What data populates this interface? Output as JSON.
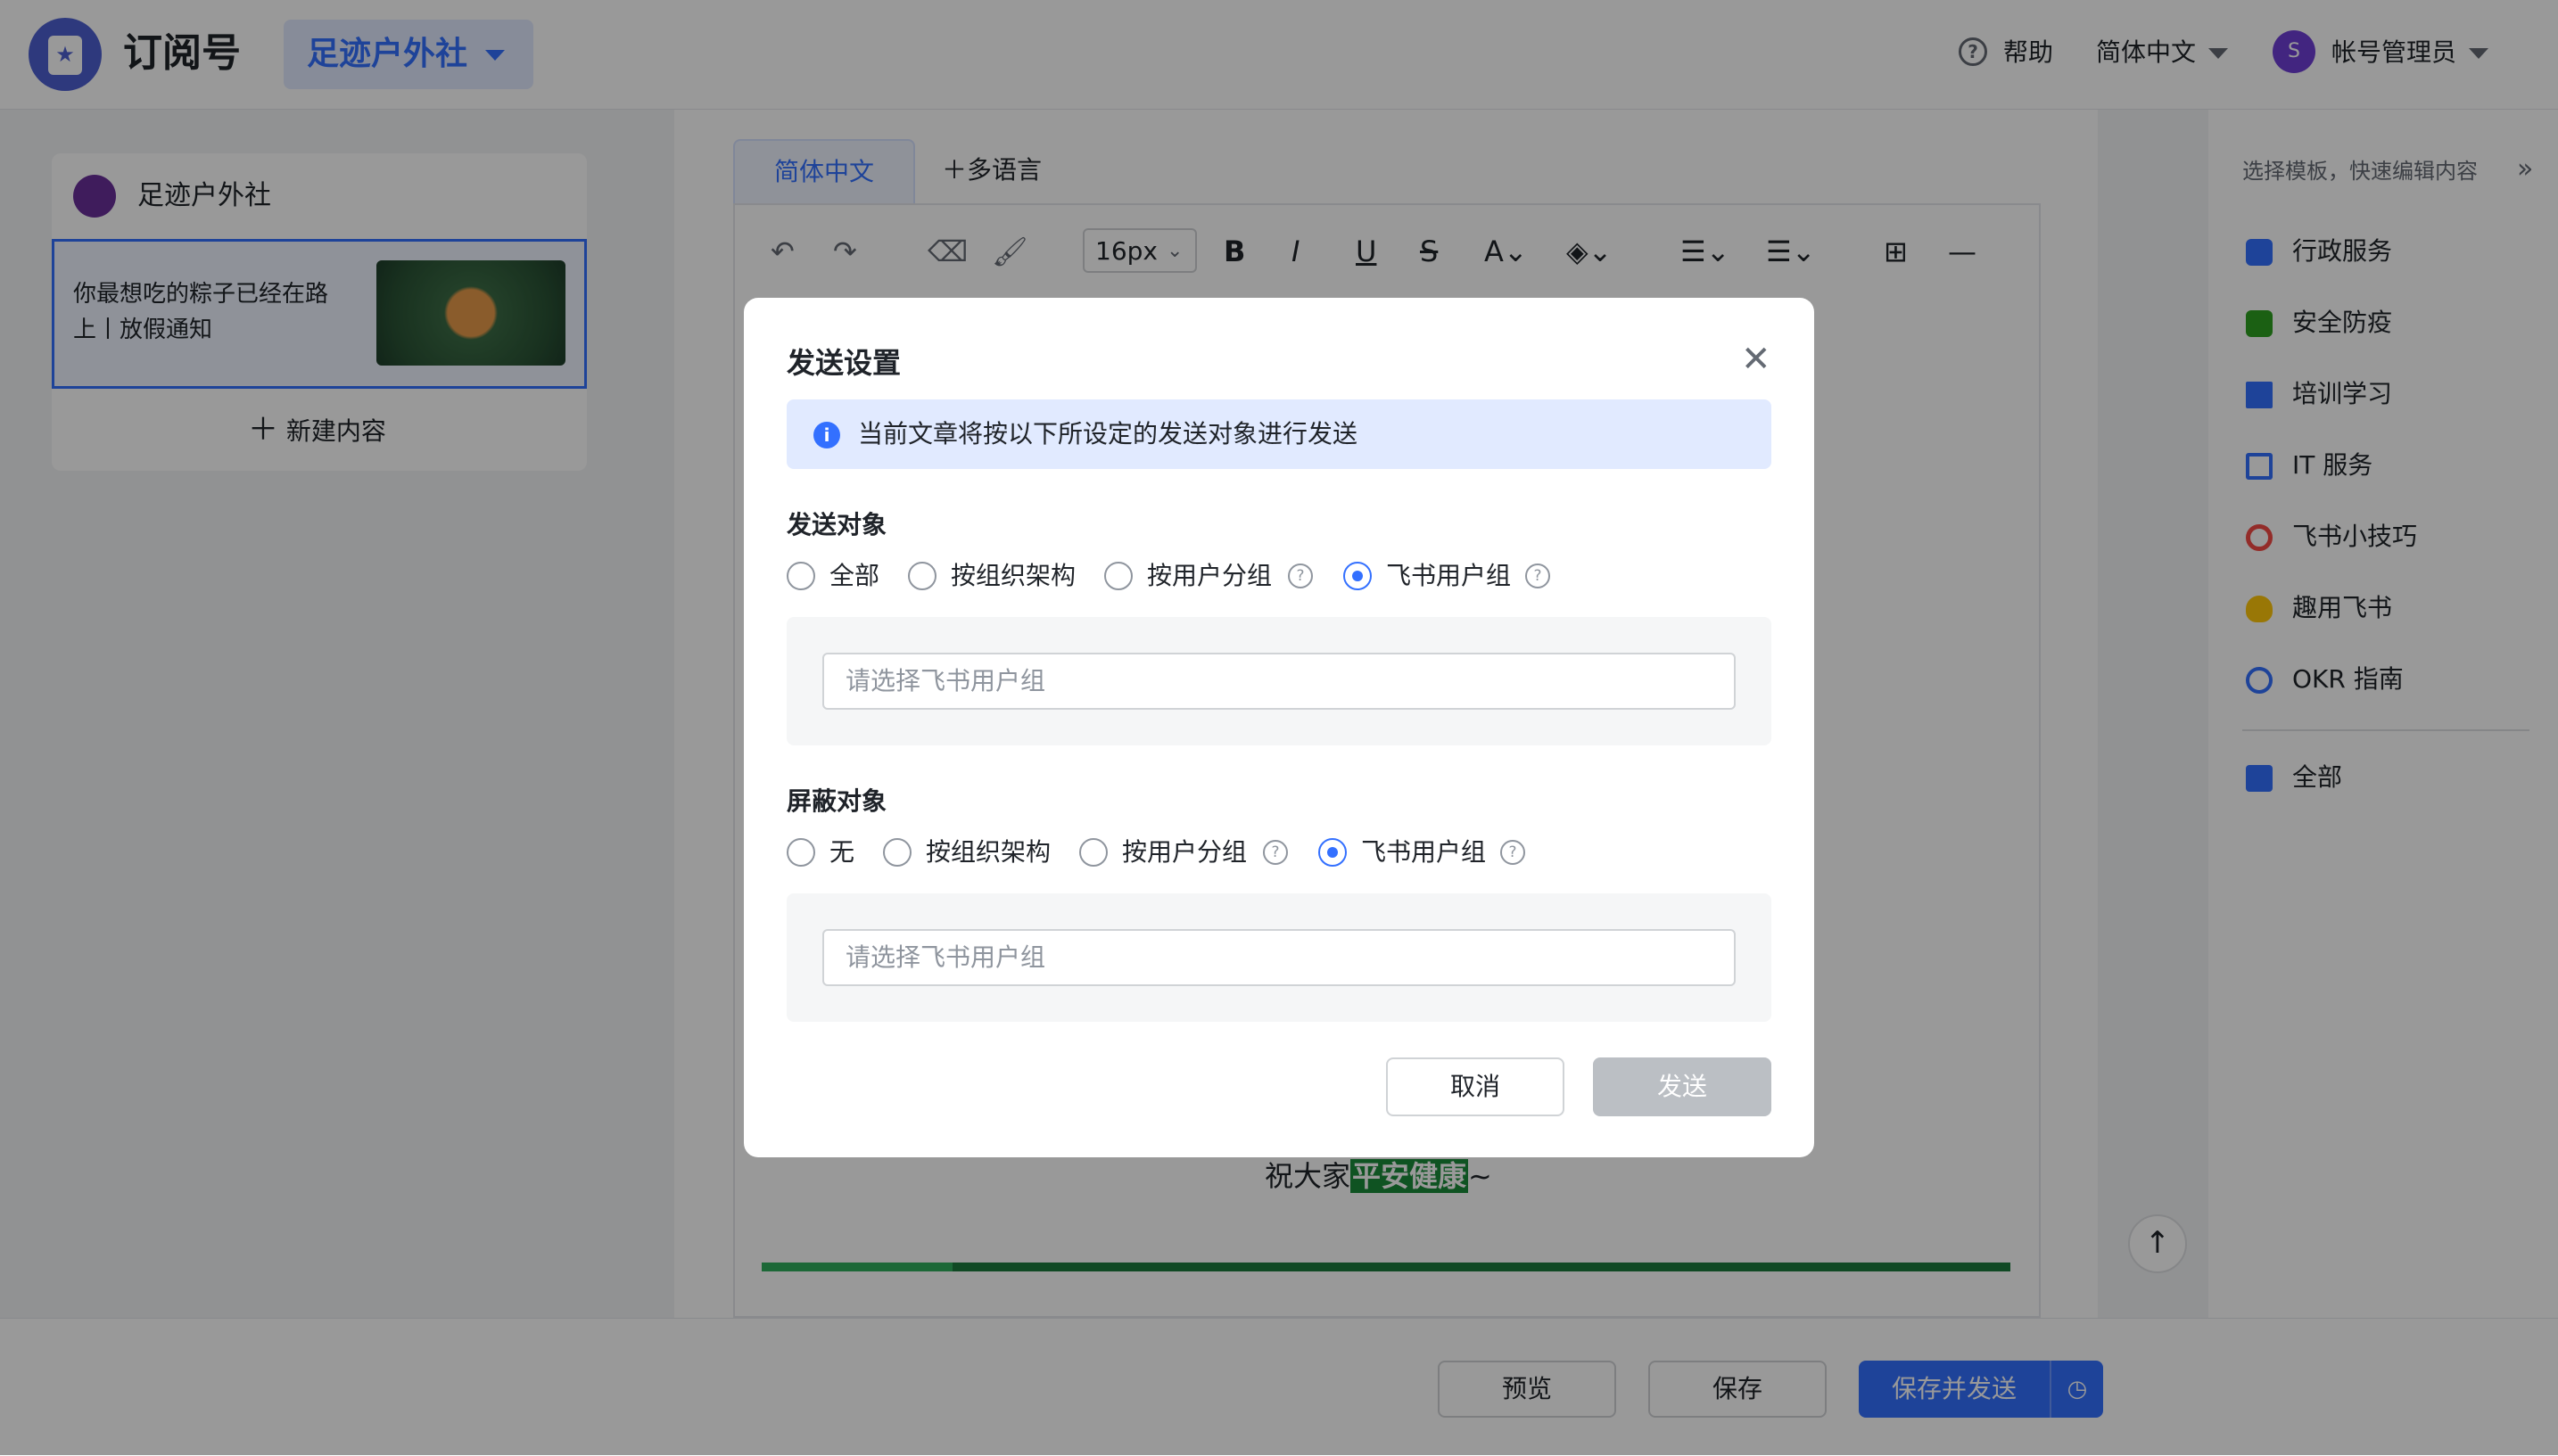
{
  "header": {
    "app_title": "订阅号",
    "account_selector": "足迹户外社",
    "help": "帮助",
    "language": "简体中文",
    "avatar_initial": "S",
    "admin": "帐号管理员"
  },
  "left_panel": {
    "account_name": "足迹户外社",
    "items": [
      {
        "title": "你最想吃的粽子已经在路上丨放假通知"
      }
    ],
    "new_content": "新建内容"
  },
  "editor": {
    "tabs": [
      {
        "label": "简体中文",
        "active": true
      },
      {
        "label": "多语言",
        "active": false
      }
    ],
    "font_size": "16px",
    "greeting_prefix": "祝大家",
    "greeting_highlight": "平安健康",
    "greeting_suffix": "~"
  },
  "right_panel": {
    "hint": "选择模板，快速编辑内容",
    "templates": [
      {
        "label": "行政服务",
        "icon": "folder-icon",
        "color": "#3370ff"
      },
      {
        "label": "安全防疫",
        "icon": "medkit-icon",
        "color": "#2ea121"
      },
      {
        "label": "培训学习",
        "icon": "graduation-cap-icon",
        "color": "#3370ff"
      },
      {
        "label": "IT 服务",
        "icon": "laptop-icon",
        "color": "#3370ff"
      },
      {
        "label": "飞书小技巧",
        "icon": "award-icon",
        "color": "#f54a45"
      },
      {
        "label": "趣用飞书",
        "icon": "lightbulb-icon",
        "color": "#ffc60a"
      },
      {
        "label": "OKR 指南",
        "icon": "target-icon",
        "color": "#3370ff"
      }
    ],
    "all": {
      "label": "全部",
      "icon": "grid-icon",
      "color": "#3370ff"
    }
  },
  "footer": {
    "preview": "预览",
    "save": "保存",
    "save_and_send": "保存并发送"
  },
  "modal": {
    "title": "发送设置",
    "notice": "当前文章将按以下所设定的发送对象进行发送",
    "send_target": {
      "label": "发送对象",
      "options": [
        {
          "label": "全部",
          "checked": false
        },
        {
          "label": "按组织架构",
          "checked": false
        },
        {
          "label": "按用户分组",
          "checked": false
        },
        {
          "label": "飞书用户组",
          "checked": true
        }
      ],
      "placeholder": "请选择飞书用户组"
    },
    "block_target": {
      "label": "屏蔽对象",
      "options": [
        {
          "label": "无",
          "checked": false
        },
        {
          "label": "按组织架构",
          "checked": false
        },
        {
          "label": "按用户分组",
          "checked": false
        },
        {
          "label": "飞书用户组",
          "checked": true
        }
      ],
      "placeholder": "请选择飞书用户组"
    },
    "cancel": "取消",
    "send": "发送"
  },
  "colors": {
    "accent": "#3370ff",
    "disabled_button": "#bbbfc4",
    "notice_bg": "#e1eaff",
    "highlight_green": "#1a8a3a"
  }
}
